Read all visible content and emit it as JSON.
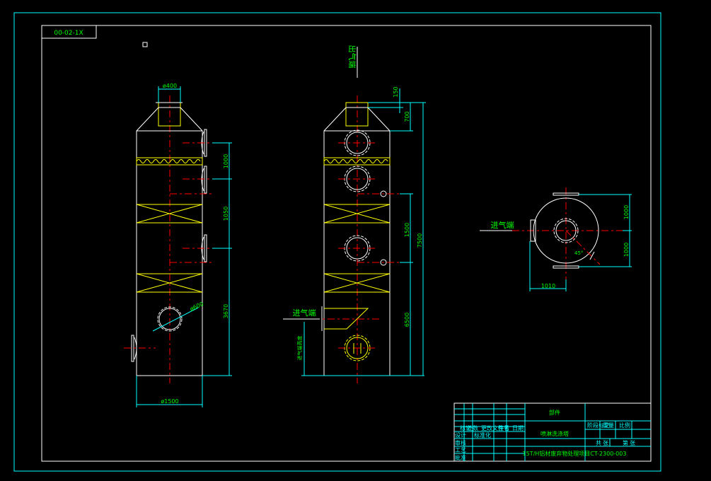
{
  "drawing": {
    "code_box": "00-02-1X",
    "colors": {
      "background": "#000000",
      "outline": "#ffffff",
      "dimension": "#00ffff",
      "center_line": "#ff0000",
      "packing": "#ffff00",
      "text": "#00ff00"
    }
  },
  "left_view": {
    "dim_top_dia": "ø400",
    "dim_bottom_dia": "ø1500",
    "dim_manhole_dia": "ø600",
    "dim_1": "1000",
    "dim_2": "1050",
    "dim_3": "3670"
  },
  "front_view": {
    "outlet_label": "出气端",
    "inlet_label": "进气端",
    "dim_top": "150",
    "dim_cone": "700",
    "dim_mid": "1500",
    "dim_total": "7500",
    "dim_lower": "6500",
    "dim_inlet_height": "进气端高度"
  },
  "top_view": {
    "inlet_label": "进气端",
    "dim_upper": "1000",
    "dim_lower": "1000",
    "dim_horizontal": "1010",
    "angle": "45°"
  },
  "title_block": {
    "part_label": "部件",
    "name": "喷淋洗涤塔",
    "project": "15T/H铝材废弃物处理项目CT-2300-003",
    "left_labels": [
      "标记",
      "处数",
      "更改文件号",
      "签名",
      "日期",
      "设计",
      "标准化",
      "审核",
      "工艺",
      "批准"
    ],
    "right_labels": [
      "阶段标记",
      "重量",
      "比例",
      "共",
      "张",
      "第",
      "张"
    ]
  }
}
